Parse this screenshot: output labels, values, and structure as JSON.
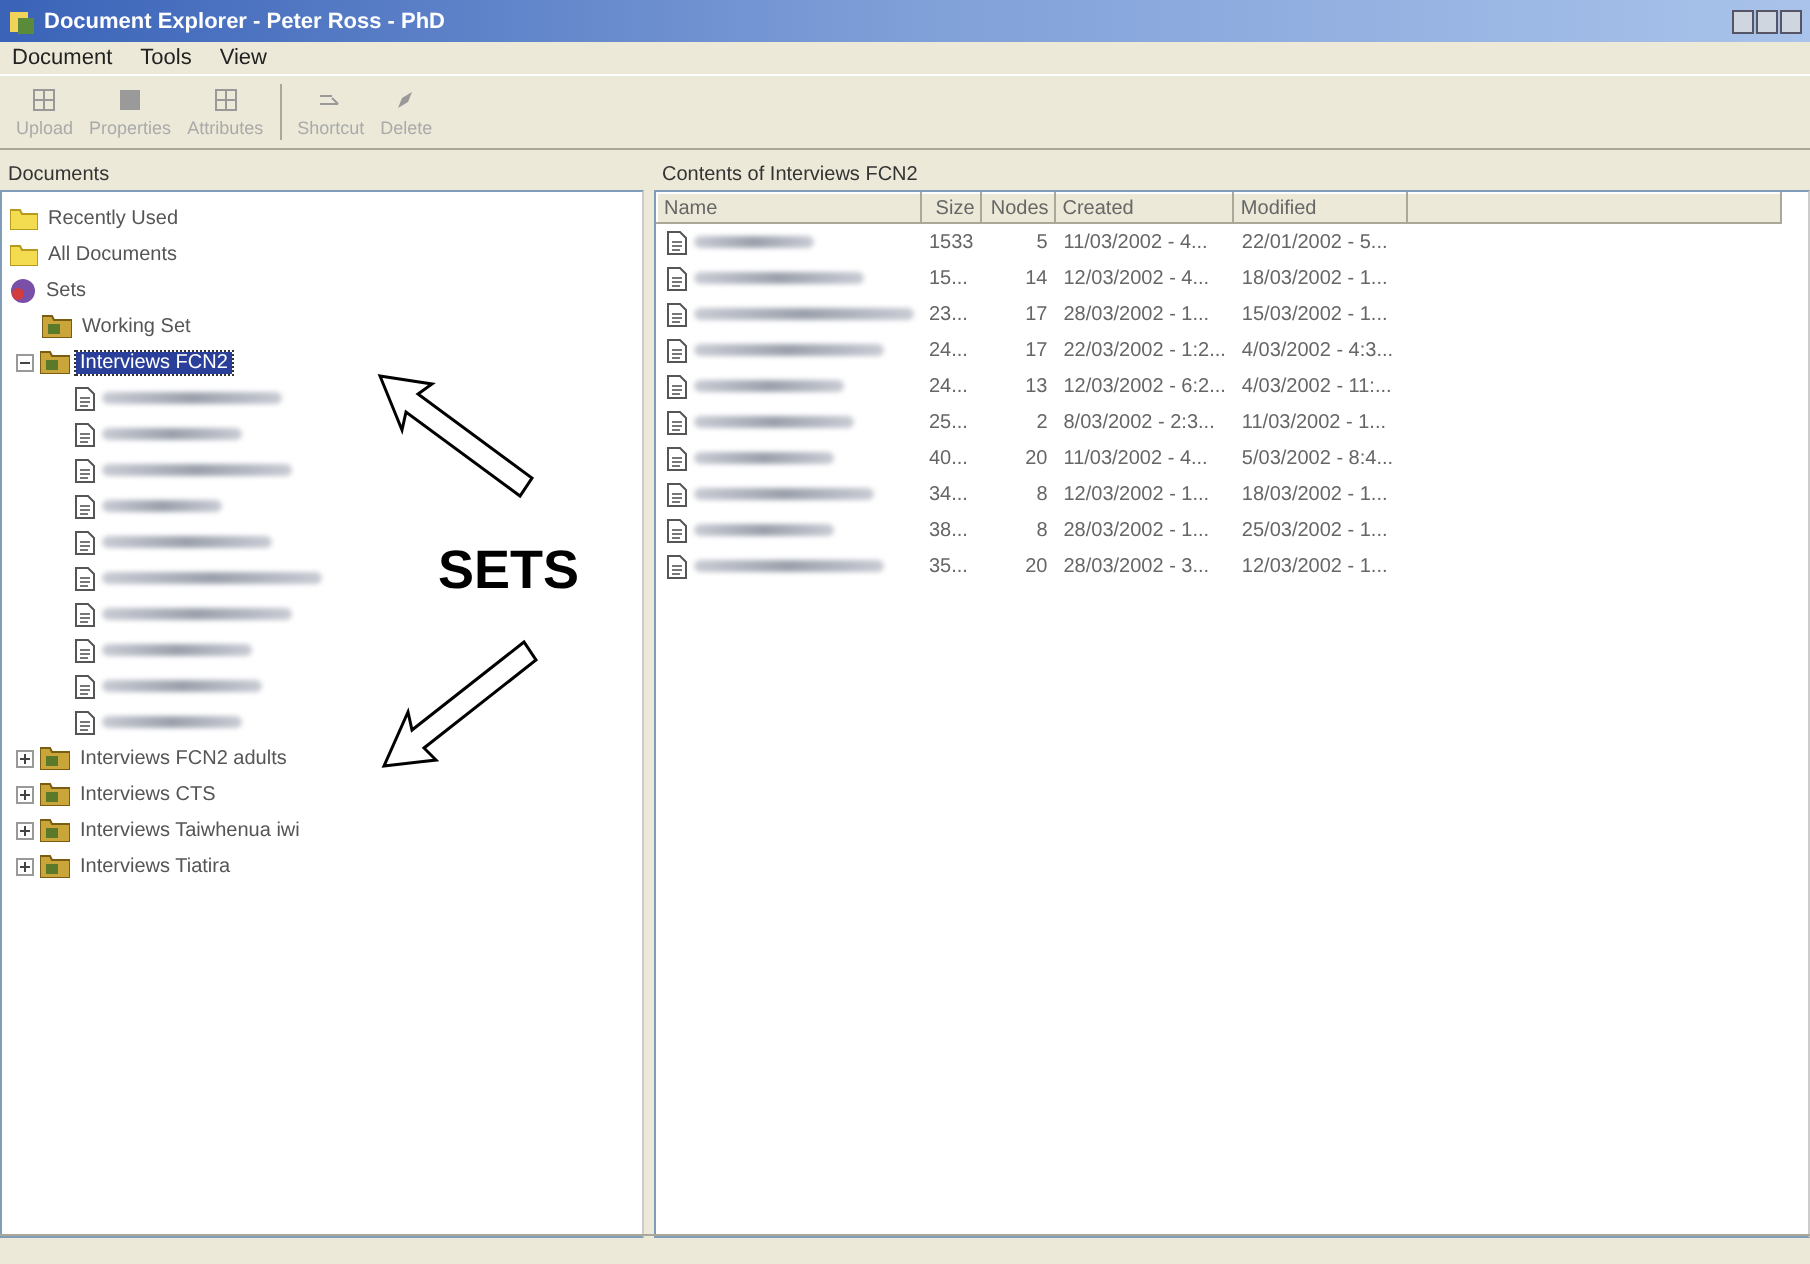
{
  "window": {
    "title": "Document Explorer - Peter Ross - PhD"
  },
  "menu": [
    "Document",
    "Tools",
    "View"
  ],
  "toolbar": [
    {
      "label": "Upload",
      "disabled": true
    },
    {
      "label": "Properties",
      "disabled": true
    },
    {
      "label": "Attributes",
      "disabled": true
    },
    {
      "label": "Shortcut",
      "disabled": true
    },
    {
      "label": "Delete",
      "disabled": true
    }
  ],
  "left_pane": {
    "title": "Documents",
    "tree": [
      {
        "label": "Recently Used",
        "kind": "folder"
      },
      {
        "label": "All Documents",
        "kind": "folder"
      },
      {
        "label": "Sets",
        "kind": "sets",
        "children": [
          {
            "label": "Working Set",
            "kind": "set"
          },
          {
            "label": "Interviews FCN2",
            "kind": "set",
            "expanded": true,
            "selected": true,
            "children": [
              {
                "kind": "document"
              },
              {
                "kind": "document"
              },
              {
                "kind": "document"
              },
              {
                "kind": "document"
              },
              {
                "kind": "document"
              },
              {
                "kind": "document"
              },
              {
                "kind": "document"
              },
              {
                "kind": "document"
              },
              {
                "kind": "document"
              },
              {
                "kind": "document"
              }
            ]
          },
          {
            "label": "Interviews FCN2 adults",
            "kind": "set",
            "expanded": false,
            "selected": false
          },
          {
            "label": "Interviews CTS",
            "kind": "set",
            "expanded": false,
            "selected": false
          },
          {
            "label": "Interviews Taiwhenua iwi",
            "kind": "set",
            "expanded": false,
            "selected": false
          },
          {
            "label": "Interviews Tiatira",
            "kind": "set",
            "expanded": false,
            "selected": false
          }
        ]
      }
    ]
  },
  "right_pane": {
    "title": "Contents of Interviews FCN2",
    "table": {
      "columns": [
        "Name",
        "Size",
        "Nodes",
        "Created",
        "Modified"
      ],
      "rows": [
        {
          "size": "1533",
          "nodes": "5",
          "created": "11/03/2002 - 4...",
          "modified": "22/01/2002 - 5..."
        },
        {
          "size": "15...",
          "nodes": "14",
          "created": "12/03/2002 - 4...",
          "modified": "18/03/2002 - 1..."
        },
        {
          "size": "23...",
          "nodes": "17",
          "created": "28/03/2002 - 1...",
          "modified": "15/03/2002 - 1..."
        },
        {
          "size": "24...",
          "nodes": "17",
          "created": "22/03/2002 - 1:2...",
          "modified": "4/03/2002 - 4:3..."
        },
        {
          "size": "24...",
          "nodes": "13",
          "created": "12/03/2002 - 6:2...",
          "modified": "4/03/2002 - 11:..."
        },
        {
          "size": "25...",
          "nodes": "2",
          "created": "8/03/2002 - 2:3...",
          "modified": "11/03/2002 - 1..."
        },
        {
          "size": "40...",
          "nodes": "20",
          "created": "11/03/2002 - 4...",
          "modified": "5/03/2002 - 8:4..."
        },
        {
          "size": "34...",
          "nodes": "8",
          "created": "12/03/2002 - 1...",
          "modified": "18/03/2002 - 1..."
        },
        {
          "size": "38...",
          "nodes": "8",
          "created": "28/03/2002 - 1...",
          "modified": "25/03/2002 - 1..."
        },
        {
          "size": "35...",
          "nodes": "20",
          "created": "28/03/2002 - 3...",
          "modified": "12/03/2002 - 1..."
        }
      ]
    }
  },
  "annotation": {
    "label": "SETS"
  }
}
